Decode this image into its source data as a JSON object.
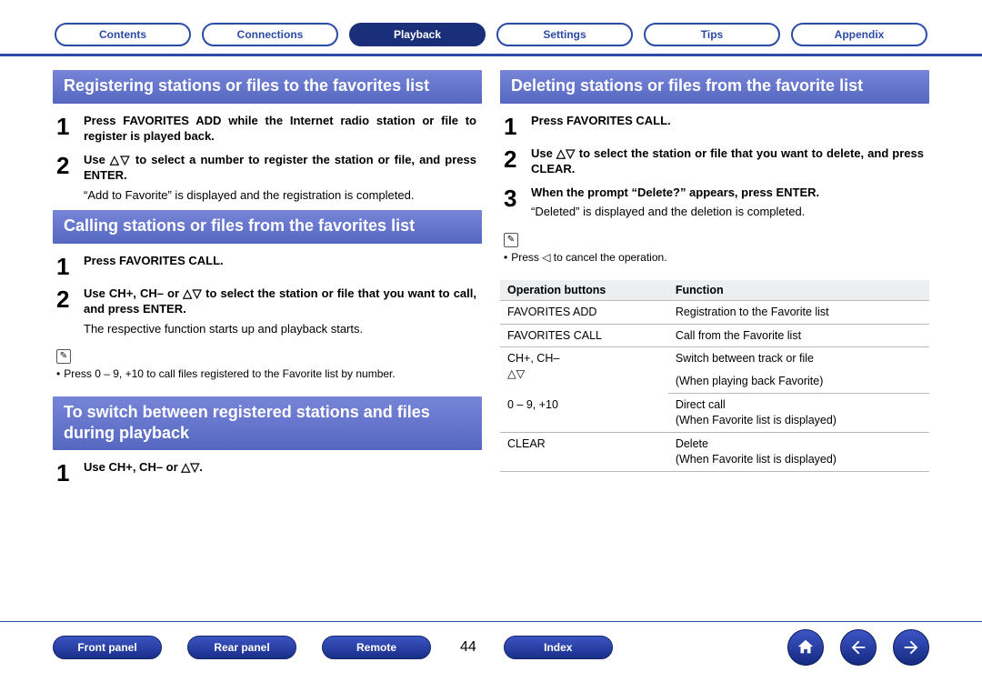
{
  "nav": {
    "tabs": [
      "Contents",
      "Connections",
      "Playback",
      "Settings",
      "Tips",
      "Appendix"
    ],
    "active_index": 2
  },
  "left": {
    "section1": {
      "title": "Registering stations or files to the favorites list",
      "steps": [
        {
          "n": "1",
          "bold": "Press FAVORITES ADD while the Internet radio station or file to register is played back."
        },
        {
          "n": "2",
          "bold": "Use △▽ to select a number to register the station or file, and press ENTER.",
          "note": "“Add to Favorite” is displayed and the registration is completed."
        }
      ]
    },
    "section2": {
      "title": "Calling stations or files from the favorites list",
      "steps": [
        {
          "n": "1",
          "bold": "Press FAVORITES CALL."
        },
        {
          "n": "2",
          "bold": "Use CH+, CH– or △▽ to select the station or file that you want to call, and press ENTER.",
          "note": "The respective function starts up and playback starts."
        }
      ],
      "note": "Press 0 – 9, +10 to call files registered to the Favorite list by number."
    },
    "section3": {
      "title": "To switch between registered stations and files during playback",
      "steps": [
        {
          "n": "1",
          "bold": "Use CH+, CH– or △▽."
        }
      ]
    }
  },
  "right": {
    "section1": {
      "title": "Deleting stations or files from the favorite list",
      "steps": [
        {
          "n": "1",
          "bold": "Press FAVORITES CALL."
        },
        {
          "n": "2",
          "bold": "Use △▽ to select the station or file that you want to delete, and press CLEAR."
        },
        {
          "n": "3",
          "bold": "When the prompt “Delete?” appears, press ENTER.",
          "note": "“Deleted” is displayed and the deletion is completed."
        }
      ],
      "note": "Press ◁ to cancel the operation."
    },
    "table": {
      "headers": [
        "Operation buttons",
        "Function"
      ],
      "rows": [
        [
          "FAVORITES ADD",
          "Registration to the Favorite list"
        ],
        [
          "FAVORITES CALL",
          "Call from the Favorite list"
        ],
        [
          "CH+, CH–",
          "Switch between track or file"
        ],
        [
          "△▽",
          "(When playing back Favorite)"
        ],
        [
          "0 – 9, +10",
          "Direct call\n(When Favorite list is displayed)"
        ],
        [
          "CLEAR",
          "Delete\n(When Favorite list is displayed)"
        ]
      ]
    }
  },
  "bottom": {
    "buttons": [
      "Front panel",
      "Rear panel",
      "Remote"
    ],
    "page": "44",
    "index": "Index"
  }
}
